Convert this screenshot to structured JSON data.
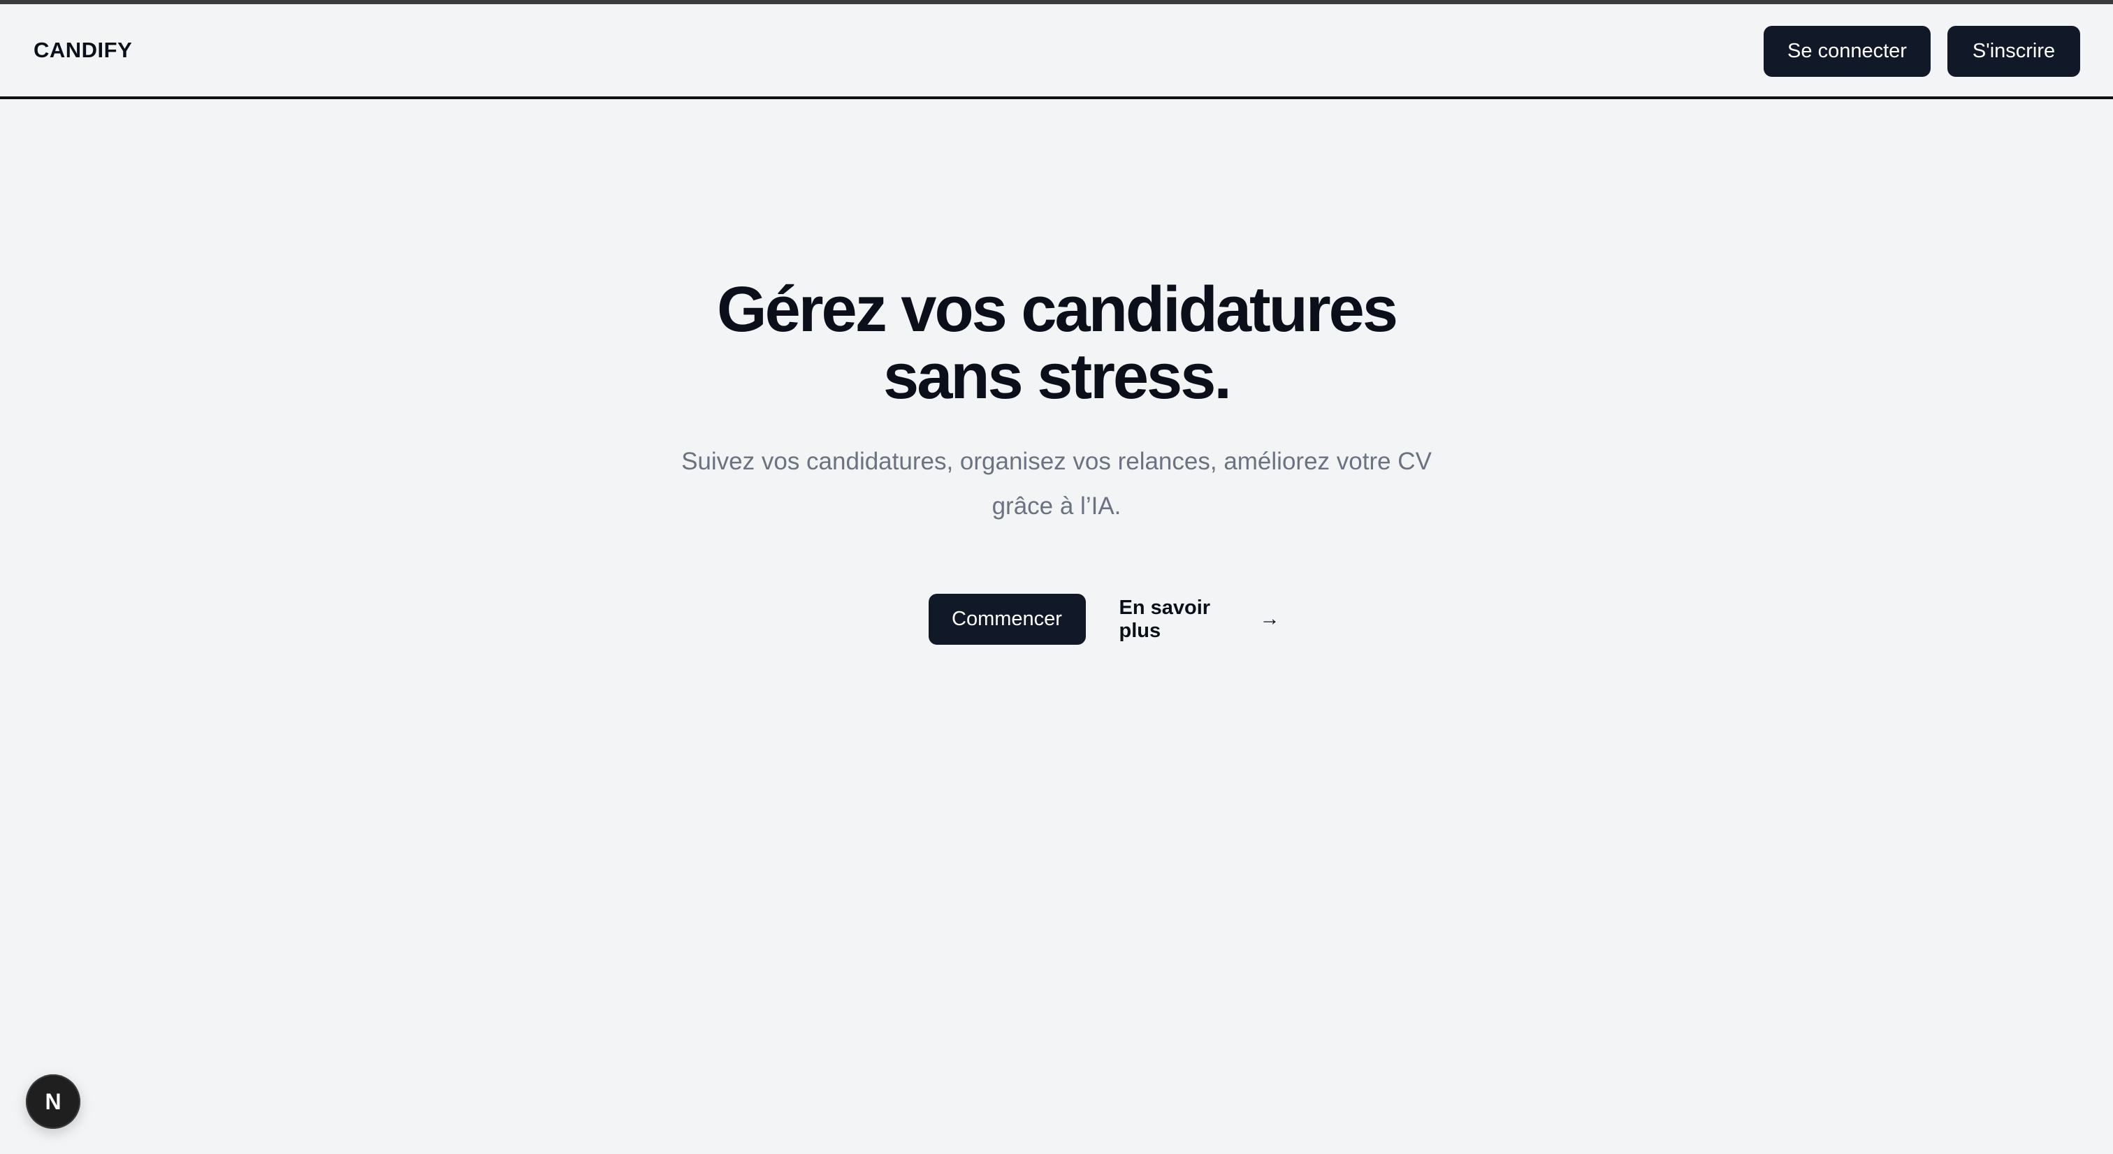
{
  "header": {
    "brand": "CANDIFY",
    "login_label": "Se connecter",
    "signup_label": "S'inscrire"
  },
  "hero": {
    "title_line1": "Gérez vos candidatures",
    "title_line2": "sans stress.",
    "subtitle_line1": "Suivez vos candidatures, organisez vos relances, améliorez votre CV",
    "subtitle_line2": "grâce à l’IA.",
    "cta_primary": "Commencer",
    "cta_secondary": "En savoir plus",
    "cta_secondary_arrow": "→"
  },
  "floating": {
    "badge_letter": "N",
    "icon": "nextjs-icon"
  },
  "colors": {
    "background": "#f3f4f6",
    "button_dark": "#111827",
    "subtitle": "#6b7280"
  }
}
